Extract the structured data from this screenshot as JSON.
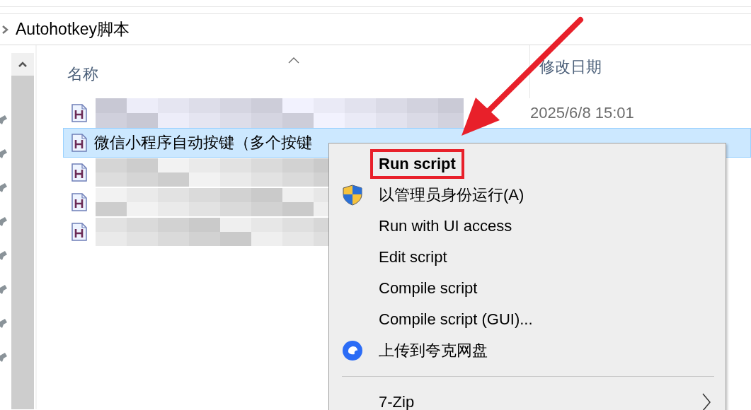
{
  "breadcrumb": {
    "label": "Autohotkey脚本"
  },
  "columns": [
    {
      "label": "名称",
      "sorted": true
    },
    {
      "label": "修改日期"
    }
  ],
  "rows": [
    {
      "kind": "redacted",
      "date": "2025/6/8 15:01",
      "selected": false
    },
    {
      "kind": "file",
      "name": "微信小程序自动按键（多个按键",
      "selected": true
    },
    {
      "kind": "redacted",
      "selected": false
    },
    {
      "kind": "redacted",
      "selected": false
    },
    {
      "kind": "redacted",
      "selected": false
    }
  ],
  "context_menu": {
    "items": [
      {
        "kind": "item",
        "label": "Run script",
        "default": true,
        "highlighted": true
      },
      {
        "kind": "shield_item",
        "label": "以管理员身份运行(A)",
        "default": false,
        "highlighted": false
      },
      {
        "kind": "item",
        "label": "Run with UI access",
        "default": false,
        "highlighted": false
      },
      {
        "kind": "item",
        "label": "Edit script",
        "default": false,
        "highlighted": false
      },
      {
        "kind": "item",
        "label": "Compile script",
        "default": false,
        "highlighted": false
      },
      {
        "kind": "item",
        "label": "Compile script (GUI)...",
        "default": false,
        "highlighted": false
      },
      {
        "kind": "cloud_item",
        "label": "上传到夸克网盘",
        "default": false,
        "highlighted": false
      },
      {
        "kind": "separator"
      },
      {
        "kind": "submenu",
        "label": "7-Zip",
        "default": false,
        "highlighted": false
      }
    ]
  }
}
